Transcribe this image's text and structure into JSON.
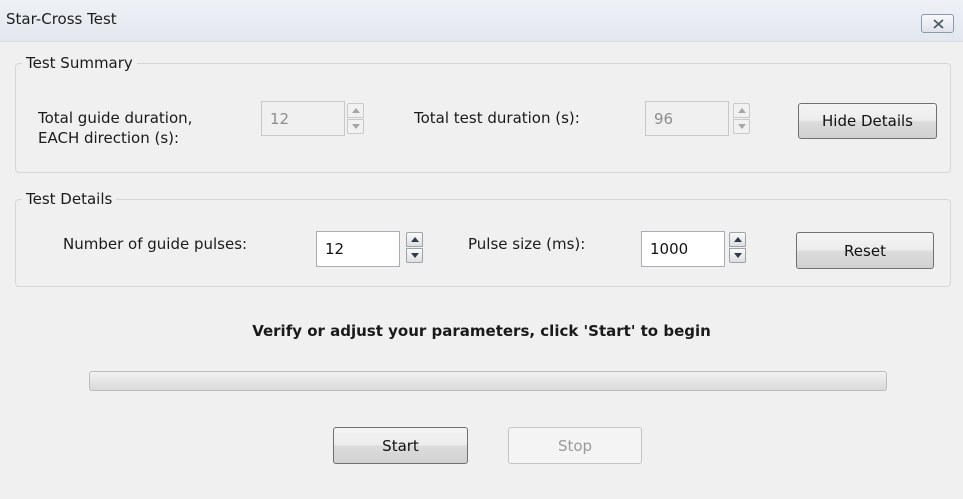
{
  "window": {
    "title": "Star-Cross Test",
    "close_icon": "close-x-icon"
  },
  "summary": {
    "title": "Test Summary",
    "guide_duration_label_line1": "Total guide duration,",
    "guide_duration_label_line2": "EACH direction (s):",
    "guide_duration_value": "12",
    "test_duration_label": "Total test duration (s):",
    "test_duration_value": "96",
    "hide_details_label": "Hide Details"
  },
  "details": {
    "title": "Test Details",
    "pulses_label": "Number of guide pulses:",
    "pulses_value": "12",
    "pulse_size_label": "Pulse size (ms):",
    "pulse_size_value": "1000",
    "reset_label": "Reset"
  },
  "status": {
    "message": "Verify or adjust your parameters, click 'Start' to begin"
  },
  "progress": {
    "fraction": 0
  },
  "controls": {
    "start_label": "Start",
    "stop_label": "Stop"
  }
}
